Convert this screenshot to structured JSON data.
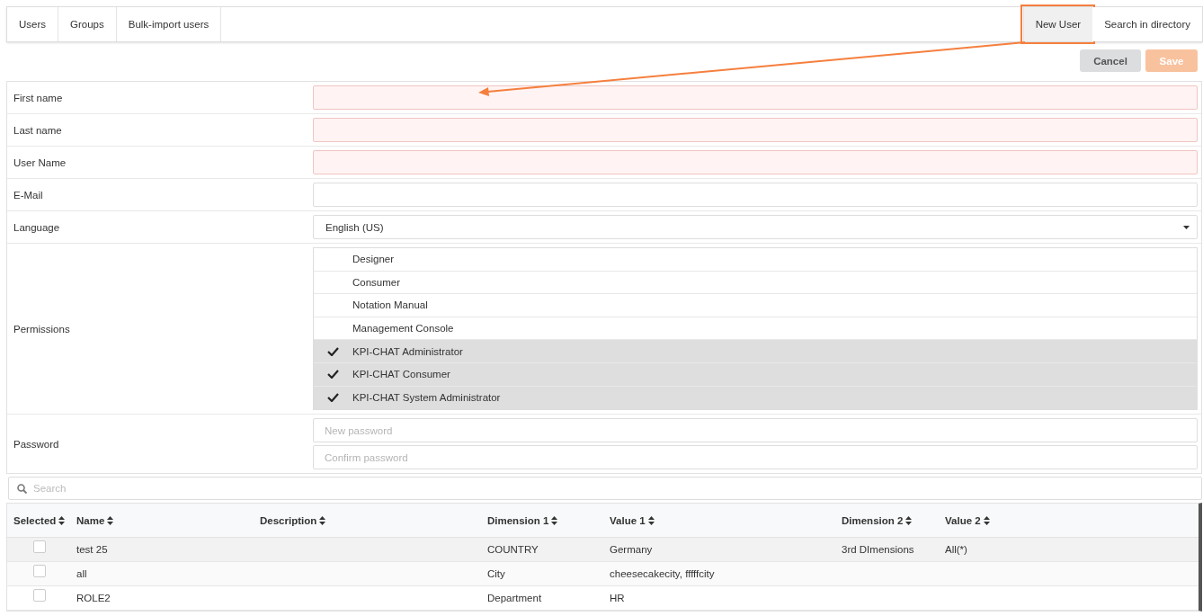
{
  "tabs": [
    {
      "label": "Users",
      "selected": false
    },
    {
      "label": "Groups",
      "selected": false
    },
    {
      "label": "Bulk-import users",
      "selected": false
    }
  ],
  "right_tabs": [
    {
      "label": "New User",
      "selected": true,
      "highlighted": true
    },
    {
      "label": "Search in directory",
      "selected": false,
      "highlighted": false
    }
  ],
  "actions": [
    {
      "label": "Cancel",
      "kind": "cancel",
      "disabled": false
    },
    {
      "label": "Save",
      "kind": "save",
      "disabled": true
    }
  ],
  "form": [
    {
      "label": "First name",
      "kind": "text",
      "invalid": true
    },
    {
      "label": "Last name",
      "kind": "text",
      "invalid": true
    },
    {
      "label": "User Name",
      "kind": "text",
      "invalid": true
    },
    {
      "label": "E-Mail",
      "kind": "text",
      "invalid": false
    },
    {
      "label": "Language",
      "kind": "select",
      "value": "English (US)"
    },
    {
      "label": "Permissions",
      "kind": "checklist",
      "items": [
        {
          "label": "Designer",
          "checked": false
        },
        {
          "label": "Consumer",
          "checked": false
        },
        {
          "label": "Notation Manual",
          "checked": false
        },
        {
          "label": "Management Console",
          "checked": false
        },
        {
          "label": "KPI-CHAT Administrator",
          "checked": true
        },
        {
          "label": "KPI-CHAT Consumer",
          "checked": true
        },
        {
          "label": "KPI-CHAT System Administrator",
          "checked": true
        }
      ]
    },
    {
      "label": "Password",
      "kind": "password",
      "placeholders": [
        "New password",
        "Confirm password"
      ]
    }
  ],
  "search": {
    "placeholder": "Search"
  },
  "table": {
    "columns": [
      "Selected",
      "Name",
      "Description",
      "Dimension 1",
      "Value 1",
      "Dimension 2",
      "Value 2"
    ],
    "rows": [
      {
        "checked": false,
        "name": "test 25",
        "description": "",
        "dimension_1": "COUNTRY",
        "value_1": "Germany",
        "dimension_2": "3rd DImensions",
        "value_2": "All(*)"
      },
      {
        "checked": false,
        "name": "all",
        "description": "",
        "dimension_1": "City",
        "value_1": "cheesecakecity, fffffcity",
        "dimension_2": "",
        "value_2": ""
      },
      {
        "checked": false,
        "name": "ROLE2",
        "description": "",
        "dimension_1": "Department",
        "value_1": "HR",
        "dimension_2": "",
        "value_2": ""
      }
    ]
  }
}
